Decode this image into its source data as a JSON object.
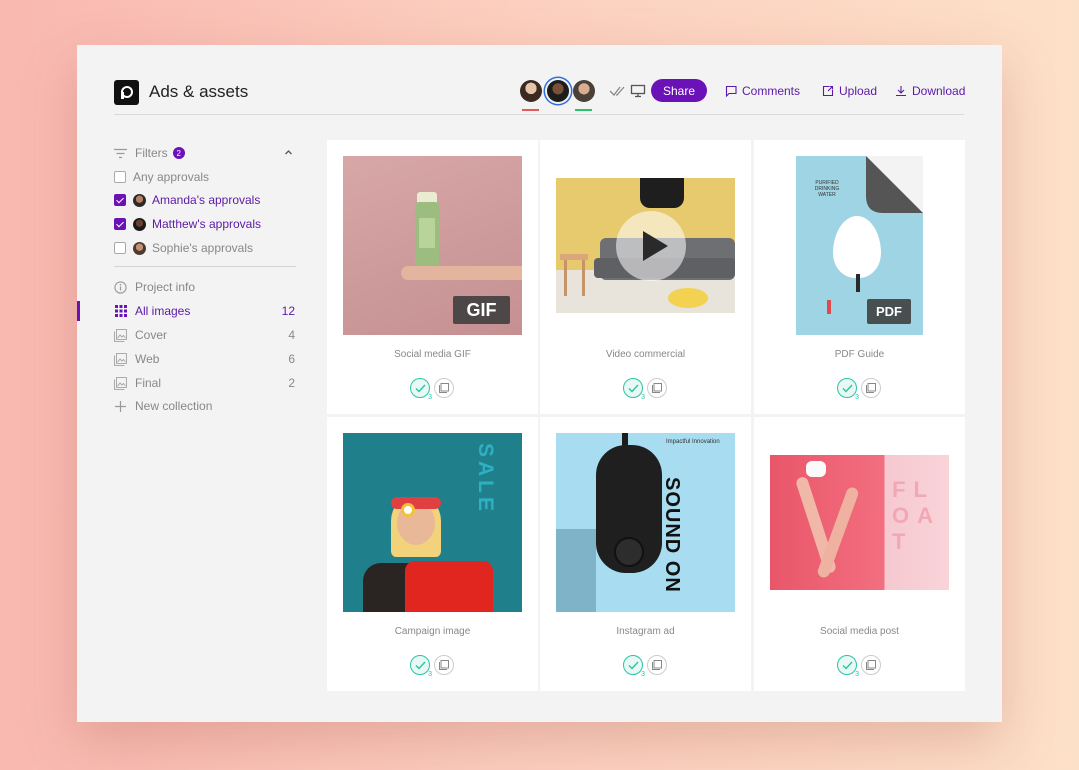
{
  "header": {
    "title": "Ads & assets",
    "share_label": "Share",
    "comments_label": "Comments",
    "upload_label": "Upload",
    "download_label": "Download"
  },
  "sidebar": {
    "filters_label": "Filters",
    "filters_count": "2",
    "approvals": [
      {
        "label": "Any approvals",
        "checked": false
      },
      {
        "label": "Amanda's approvals",
        "checked": true
      },
      {
        "label": "Matthew's approvals",
        "checked": true
      },
      {
        "label": "Sophie's approvals",
        "checked": false
      }
    ],
    "project_info_label": "Project info",
    "collections": [
      {
        "label": "All images",
        "count": "12",
        "active": true
      },
      {
        "label": "Cover",
        "count": "4"
      },
      {
        "label": "Web",
        "count": "6"
      },
      {
        "label": "Final",
        "count": "2"
      }
    ],
    "new_collection_label": "New collection"
  },
  "assets": [
    {
      "label": "Social media GIF",
      "tag": "GIF",
      "approvals": "3"
    },
    {
      "label": "Video commercial",
      "approvals": "3"
    },
    {
      "label": "PDF Guide",
      "tag": "PDF",
      "cover_text": "PURIFIED DRINKING WATER",
      "approvals": "3"
    },
    {
      "label": "Campaign image",
      "overlay_text": "SALE",
      "approvals": "3"
    },
    {
      "label": "Instagram ad",
      "overlay_small": "Impactful Innovation",
      "overlay_text": "SOUND ON",
      "approvals": "3"
    },
    {
      "label": "Social media post",
      "overlay_text": "FLOAT",
      "approvals": "3"
    }
  ],
  "colors": {
    "accent": "#6a12b8",
    "approve": "#2bc3a8"
  }
}
